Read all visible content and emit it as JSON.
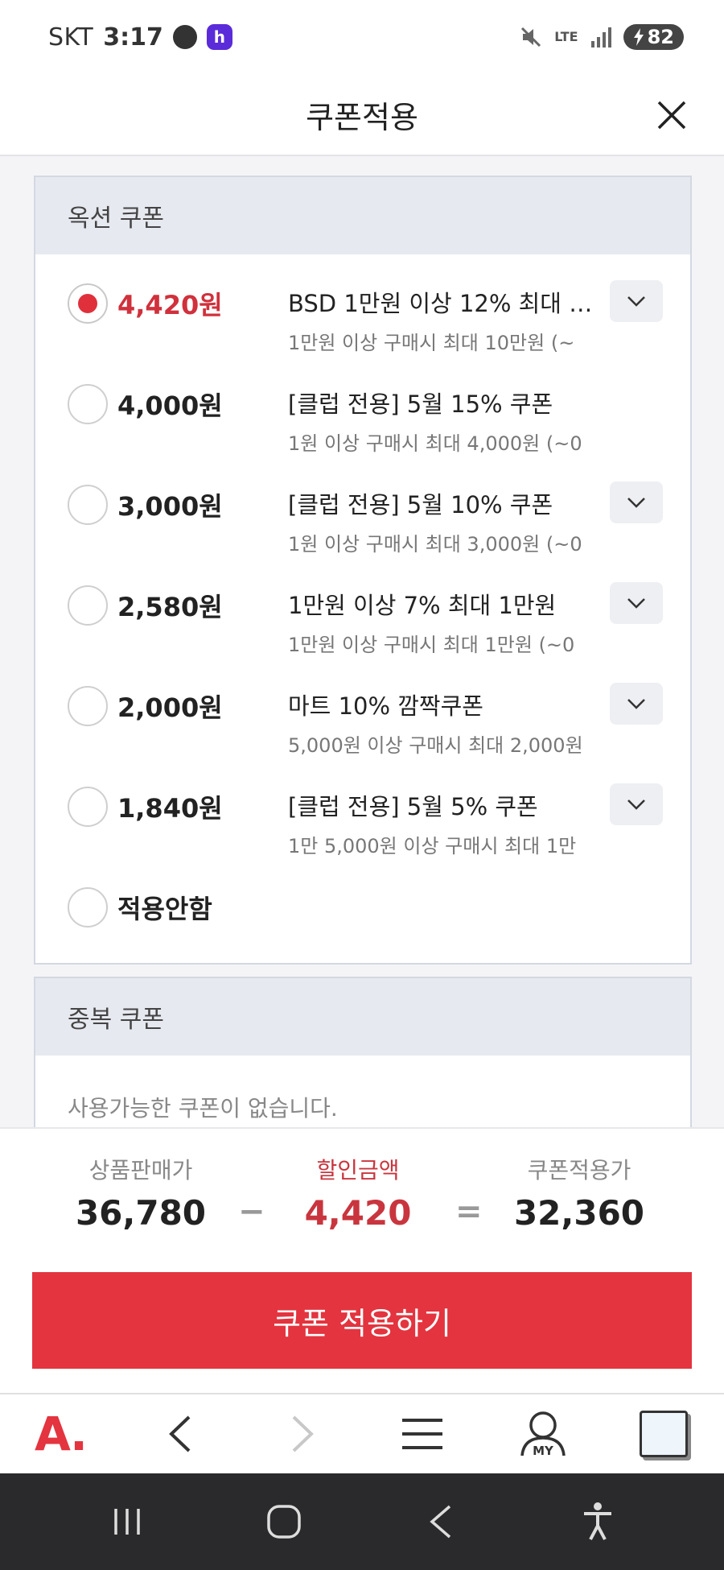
{
  "status_bar": {
    "carrier": "SKT",
    "time": "3:17",
    "app_badge": "h",
    "network": "LTE",
    "battery": "82"
  },
  "header": {
    "title": "쿠폰적용"
  },
  "option_coupons": {
    "title": "옥션 쿠폰",
    "items": [
      {
        "amount": "4,420원",
        "title": "BSD 1만원 이상 12% 최대 1…",
        "desc": "1만원 이상 구매시 최대 10만원 (~",
        "selected": true,
        "expandable": true
      },
      {
        "amount": "4,000원",
        "title": "[클럽 전용] 5월 15% 쿠폰",
        "desc": "1원 이상 구매시 최대 4,000원 (~0",
        "selected": false,
        "expandable": false
      },
      {
        "amount": "3,000원",
        "title": "[클럽 전용] 5월 10% 쿠폰",
        "desc": "1원 이상 구매시 최대 3,000원 (~0",
        "selected": false,
        "expandable": true
      },
      {
        "amount": "2,580원",
        "title": "1만원 이상 7% 최대 1만원",
        "desc": "1만원 이상 구매시 최대 1만원 (~0",
        "selected": false,
        "expandable": true
      },
      {
        "amount": "2,000원",
        "title": "마트 10% 깜짝쿠폰",
        "desc": "5,000원 이상 구매시 최대 2,000원",
        "selected": false,
        "expandable": true
      },
      {
        "amount": "1,840원",
        "title": "[클럽 전용] 5월 5% 쿠폰",
        "desc": "1만 5,000원 이상 구매시 최대 1만",
        "selected": false,
        "expandable": true
      }
    ],
    "none_label": "적용안함"
  },
  "duplicate_coupons": {
    "title": "중복 쿠폰",
    "empty_message": "사용가능한 쿠폰이 없습니다."
  },
  "summary": {
    "price_label": "상품판매가",
    "price_value": "36,780",
    "minus": "−",
    "discount_label": "할인금액",
    "discount_value": "4,420",
    "equals": "=",
    "final_label": "쿠폰적용가",
    "final_value": "32,360"
  },
  "apply_button": "쿠폰 적용하기",
  "browser_bar": {
    "logo": "A.",
    "my_label": "MY"
  },
  "colors": {
    "accent_red": "#e3343f",
    "selected_amount": "#d0313c",
    "section_header_bg": "#e6e9ef"
  }
}
